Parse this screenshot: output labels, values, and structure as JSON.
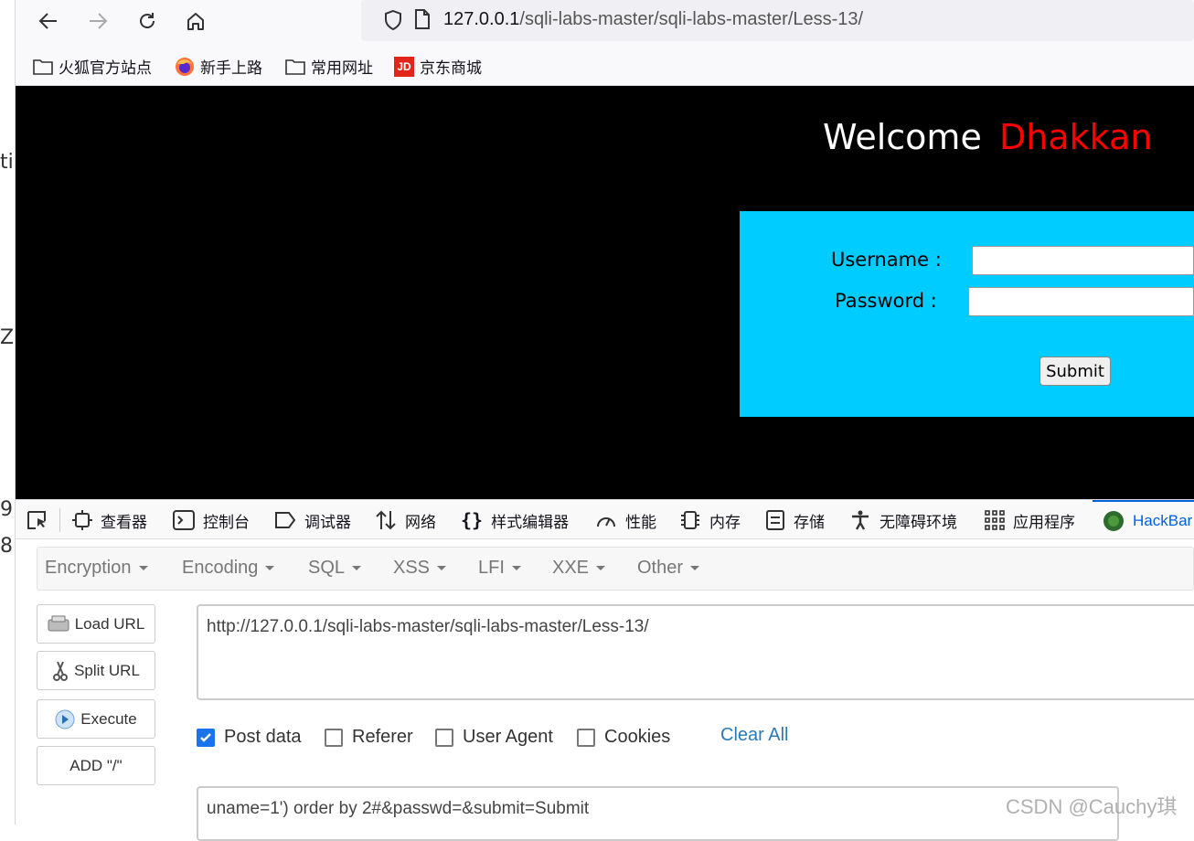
{
  "edge_glyphs": [
    "ti",
    "Z",
    "9",
    "8"
  ],
  "browser": {
    "url_host": "127.0.0.1",
    "url_path": "/sqli-labs-master/sqli-labs-master/Less-13/",
    "bookmarks": [
      {
        "label": "火狐官方站点",
        "icon": "folder-icon"
      },
      {
        "label": "新手上路",
        "icon": "firefox-icon"
      },
      {
        "label": "常用网址",
        "icon": "folder-icon"
      },
      {
        "label": "京东商城",
        "icon": "jd-logo-icon"
      }
    ],
    "jd_logo_text": "JD"
  },
  "page": {
    "welcome": "Welcome",
    "name": "Dhakkan",
    "username_label": "Username :",
    "password_label": "Password :",
    "submit_label": "Submit",
    "colors": {
      "background": "#000000",
      "form": "#00ccff",
      "name": "#ff0000"
    }
  },
  "devtools": {
    "tabs": [
      {
        "label": "查看器",
        "icon": "inspector-icon"
      },
      {
        "label": "控制台",
        "icon": "console-icon"
      },
      {
        "label": "调试器",
        "icon": "debugger-icon"
      },
      {
        "label": "网络",
        "icon": "network-icon"
      },
      {
        "label": "样式编辑器",
        "icon": "style-editor-icon"
      },
      {
        "label": "性能",
        "icon": "performance-icon"
      },
      {
        "label": "内存",
        "icon": "memory-icon"
      },
      {
        "label": "存储",
        "icon": "storage-icon"
      },
      {
        "label": "无障碍环境",
        "icon": "accessibility-icon"
      },
      {
        "label": "应用程序",
        "icon": "application-icon"
      },
      {
        "label": "HackBar",
        "icon": "hackbar-icon"
      }
    ],
    "active_tab": "HackBar"
  },
  "hackbar": {
    "menu": [
      "Encryption",
      "Encoding",
      "SQL",
      "XSS",
      "LFI",
      "XXE",
      "Other"
    ],
    "buttons": {
      "load_url": "Load URL",
      "split_url": "Split URL",
      "execute": "Execute",
      "add_slash": "ADD \"/\""
    },
    "url_value": "http://127.0.0.1/sqli-labs-master/sqli-labs-master/Less-13/",
    "checkboxes": {
      "post_data": {
        "label": "Post data",
        "checked": true
      },
      "referer": {
        "label": "Referer",
        "checked": false
      },
      "user_agent": {
        "label": "User Agent",
        "checked": false
      },
      "cookies": {
        "label": "Cookies",
        "checked": false
      }
    },
    "clear_all": "Clear All",
    "post_value": "uname=1') order by 2#&passwd=&submit=Submit"
  },
  "watermark": "CSDN @Cauchy琪"
}
